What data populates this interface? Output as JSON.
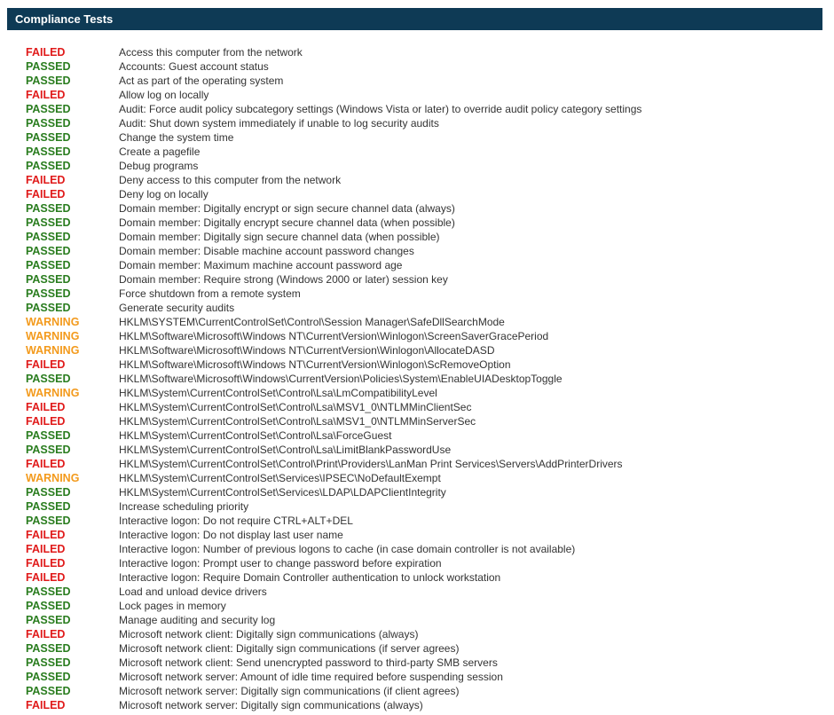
{
  "header": {
    "title": "Compliance Tests"
  },
  "colors": {
    "header_bg": "#0e3a55",
    "passed": "#2a7d1f",
    "failed": "#e01a1a",
    "warning": "#f39a1c"
  },
  "tests": [
    {
      "status": "FAILED",
      "name": "Access this computer from the network"
    },
    {
      "status": "PASSED",
      "name": "Accounts: Guest account status"
    },
    {
      "status": "PASSED",
      "name": "Act as part of the operating system"
    },
    {
      "status": "FAILED",
      "name": "Allow log on locally"
    },
    {
      "status": "PASSED",
      "name": "Audit: Force audit policy subcategory settings (Windows Vista or later) to override audit policy category settings"
    },
    {
      "status": "PASSED",
      "name": "Audit: Shut down system immediately if unable to log security audits"
    },
    {
      "status": "PASSED",
      "name": "Change the system time"
    },
    {
      "status": "PASSED",
      "name": "Create a pagefile"
    },
    {
      "status": "PASSED",
      "name": "Debug programs"
    },
    {
      "status": "FAILED",
      "name": "Deny access to this computer from the network"
    },
    {
      "status": "FAILED",
      "name": "Deny log on locally"
    },
    {
      "status": "PASSED",
      "name": "Domain member: Digitally encrypt or sign secure channel data (always)"
    },
    {
      "status": "PASSED",
      "name": "Domain member: Digitally encrypt secure channel data (when possible)"
    },
    {
      "status": "PASSED",
      "name": "Domain member: Digitally sign secure channel data (when possible)"
    },
    {
      "status": "PASSED",
      "name": "Domain member: Disable machine account password changes"
    },
    {
      "status": "PASSED",
      "name": "Domain member: Maximum machine account password age"
    },
    {
      "status": "PASSED",
      "name": "Domain member: Require strong (Windows 2000 or later) session key"
    },
    {
      "status": "PASSED",
      "name": "Force shutdown from a remote system"
    },
    {
      "status": "PASSED",
      "name": "Generate security audits"
    },
    {
      "status": "WARNING",
      "name": "HKLM\\SYSTEM\\CurrentControlSet\\Control\\Session Manager\\SafeDllSearchMode"
    },
    {
      "status": "WARNING",
      "name": "HKLM\\Software\\Microsoft\\Windows NT\\CurrentVersion\\Winlogon\\ScreenSaverGracePeriod"
    },
    {
      "status": "WARNING",
      "name": "HKLM\\Software\\Microsoft\\Windows NT\\CurrentVersion\\Winlogon\\AllocateDASD"
    },
    {
      "status": "FAILED",
      "name": "HKLM\\Software\\Microsoft\\Windows NT\\CurrentVersion\\Winlogon\\ScRemoveOption"
    },
    {
      "status": "PASSED",
      "name": "HKLM\\Software\\Microsoft\\Windows\\CurrentVersion\\Policies\\System\\EnableUIADesktopToggle"
    },
    {
      "status": "WARNING",
      "name": "HKLM\\System\\CurrentControlSet\\Control\\Lsa\\LmCompatibilityLevel"
    },
    {
      "status": "FAILED",
      "name": "HKLM\\System\\CurrentControlSet\\Control\\Lsa\\MSV1_0\\NTLMMinClientSec"
    },
    {
      "status": "FAILED",
      "name": "HKLM\\System\\CurrentControlSet\\Control\\Lsa\\MSV1_0\\NTLMMinServerSec"
    },
    {
      "status": "PASSED",
      "name": "HKLM\\System\\CurrentControlSet\\Control\\Lsa\\ForceGuest"
    },
    {
      "status": "PASSED",
      "name": "HKLM\\System\\CurrentControlSet\\Control\\Lsa\\LimitBlankPasswordUse"
    },
    {
      "status": "FAILED",
      "name": "HKLM\\System\\CurrentControlSet\\Control\\Print\\Providers\\LanMan Print Services\\Servers\\AddPrinterDrivers"
    },
    {
      "status": "WARNING",
      "name": "HKLM\\System\\CurrentControlSet\\Services\\IPSEC\\NoDefaultExempt"
    },
    {
      "status": "PASSED",
      "name": "HKLM\\System\\CurrentControlSet\\Services\\LDAP\\LDAPClientIntegrity"
    },
    {
      "status": "PASSED",
      "name": "Increase scheduling priority"
    },
    {
      "status": "PASSED",
      "name": "Interactive logon: Do not require CTRL+ALT+DEL"
    },
    {
      "status": "FAILED",
      "name": "Interactive logon: Do not display last user name"
    },
    {
      "status": "FAILED",
      "name": "Interactive logon: Number of previous logons to cache (in case domain controller is not available)"
    },
    {
      "status": "FAILED",
      "name": "Interactive logon: Prompt user to change password before expiration"
    },
    {
      "status": "FAILED",
      "name": "Interactive logon: Require Domain Controller authentication to unlock workstation"
    },
    {
      "status": "PASSED",
      "name": "Load and unload device drivers"
    },
    {
      "status": "PASSED",
      "name": "Lock pages in memory"
    },
    {
      "status": "PASSED",
      "name": "Manage auditing and security log"
    },
    {
      "status": "FAILED",
      "name": "Microsoft network client: Digitally sign communications (always)"
    },
    {
      "status": "PASSED",
      "name": "Microsoft network client: Digitally sign communications (if server agrees)"
    },
    {
      "status": "PASSED",
      "name": "Microsoft network client: Send unencrypted password to third-party SMB servers"
    },
    {
      "status": "PASSED",
      "name": "Microsoft network server: Amount of idle time required before suspending session"
    },
    {
      "status": "PASSED",
      "name": "Microsoft network server: Digitally sign communications (if client agrees)"
    },
    {
      "status": "FAILED",
      "name": "Microsoft network server: Digitally sign communications (always)"
    }
  ]
}
